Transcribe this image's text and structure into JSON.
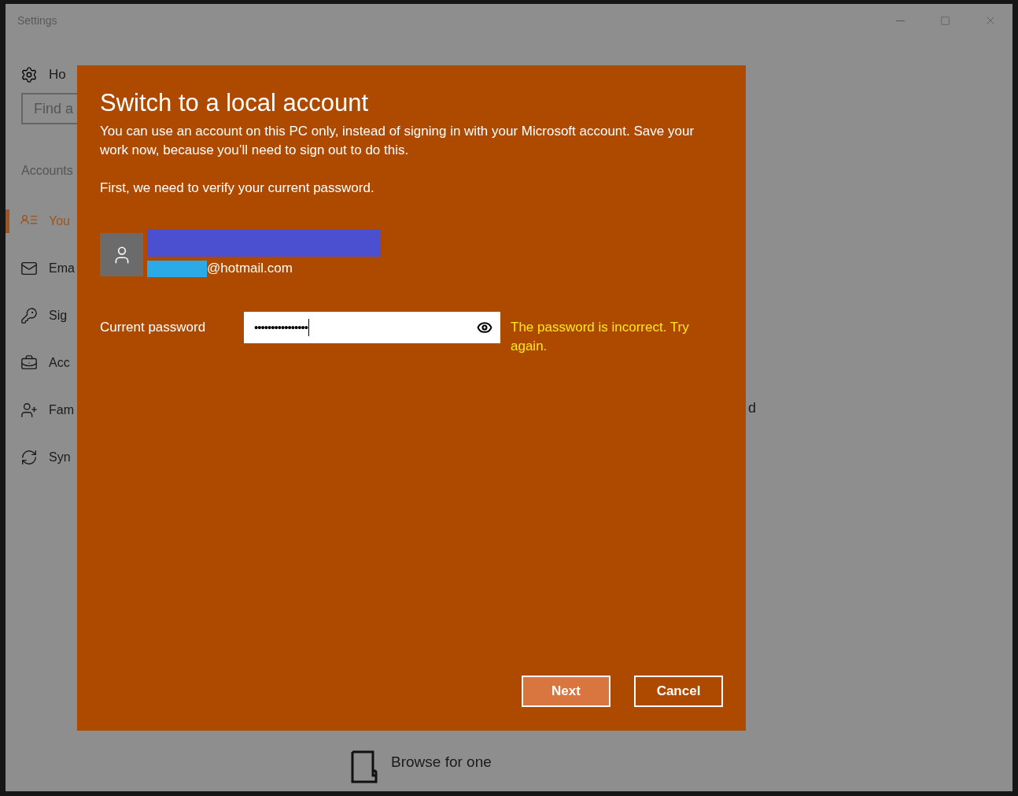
{
  "window": {
    "title": "Settings",
    "controls": [
      {
        "kind": "minimize"
      },
      {
        "kind": "maximize"
      },
      {
        "kind": "close"
      }
    ]
  },
  "sidebar": {
    "home": {
      "label": "Ho"
    },
    "search": {
      "placeholder": "Find a"
    },
    "section": "Accounts",
    "items": [
      {
        "label": "You",
        "selected": true
      },
      {
        "label": "Ema",
        "selected": false
      },
      {
        "label": "Sig",
        "selected": false
      },
      {
        "label": "Acc",
        "selected": false
      },
      {
        "label": "Fam",
        "selected": false
      },
      {
        "label": "Syn",
        "selected": false
      }
    ]
  },
  "content": {
    "fragment": "d",
    "browse": {
      "label": "Browse for one"
    }
  },
  "dialog": {
    "title": "Switch to a local account",
    "description": "You can use an account on this PC only, instead of signing in with your Microsoft account. Save your work now, because you’ll need to sign out to do this.",
    "prompt": "First, we need to verify your current password.",
    "account": {
      "email_domain": "@hotmail.com"
    },
    "password": {
      "label": "Current password",
      "value": "••••••••••••••••",
      "error": "The password is incorrect. Try again."
    },
    "buttons": [
      {
        "label": "Next",
        "kind": "primary"
      },
      {
        "label": "Cancel",
        "kind": "secondary"
      }
    ]
  }
}
